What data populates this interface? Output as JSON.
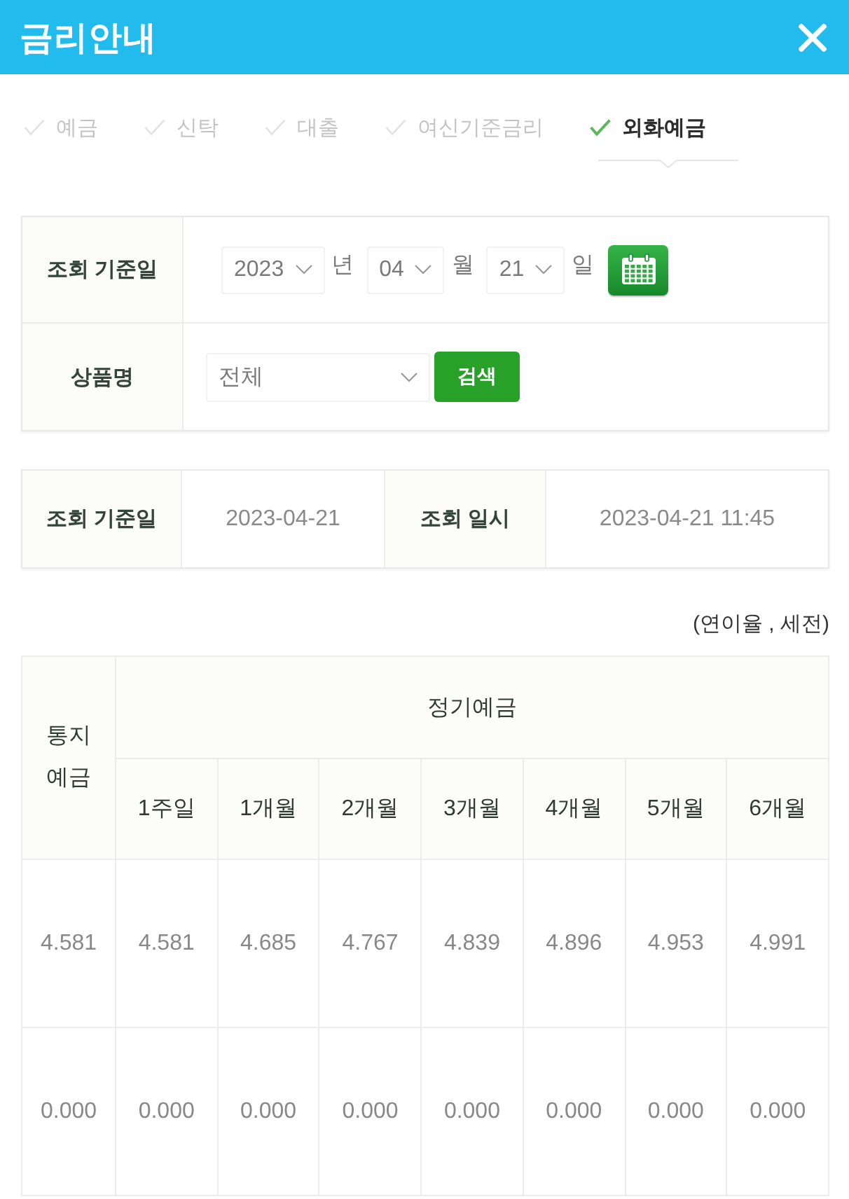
{
  "window": {
    "title": "금리안내"
  },
  "tabs": [
    {
      "label": "예금",
      "selected": false
    },
    {
      "label": "신탁",
      "selected": false
    },
    {
      "label": "대출",
      "selected": false
    },
    {
      "label": "여신기준금리",
      "selected": false
    },
    {
      "label": "외화예금",
      "selected": true
    }
  ],
  "search_form": {
    "date_row": {
      "label": "조회 기준일",
      "parts": [
        {
          "value": "2023",
          "unit": "년"
        },
        {
          "value": "04",
          "unit": "월"
        },
        {
          "value": "21",
          "unit": "일"
        }
      ]
    },
    "product_row": {
      "label": "상품명",
      "value": "전체",
      "button": "검색"
    }
  },
  "query_info": [
    {
      "label": "조회 기준일",
      "value": "2023-04-21"
    },
    {
      "label": "조회 일시",
      "value": "2023-04-21 11:45"
    }
  ],
  "rate_note": "(연이율 , 세전)",
  "rate_table": {
    "header_rows": [
      [
        {
          "text": "통지예금",
          "rowspan": 2
        },
        {
          "text": "정기예금",
          "colspan": 7
        }
      ],
      [
        {
          "text": "1주일"
        },
        {
          "text": "1개월"
        },
        {
          "text": "2개월"
        },
        {
          "text": "3개월"
        },
        {
          "text": "4개월"
        },
        {
          "text": "5개월"
        },
        {
          "text": "6개월"
        }
      ]
    ],
    "rows": [
      [
        "4.581",
        "4.581",
        "4.685",
        "4.767",
        "4.839",
        "4.896",
        "4.953",
        "4.991"
      ],
      [
        "0.000",
        "0.000",
        "0.000",
        "0.000",
        "0.000",
        "0.000",
        "0.000",
        "0.000"
      ]
    ]
  }
}
